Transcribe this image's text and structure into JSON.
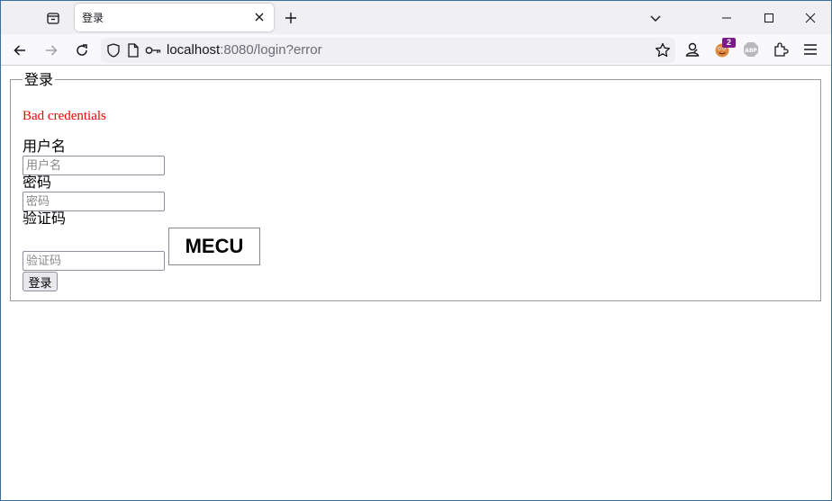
{
  "tab": {
    "title": "登录"
  },
  "browser": {
    "url_host": "localhost",
    "url_rest": ":8080/login?error",
    "extension_badge": "2",
    "icons": [
      "tab-list-icon",
      "close-icon",
      "plus-icon",
      "chevron-down-icon",
      "minimize-icon",
      "maximize-icon",
      "close-icon",
      "back-arrow-icon",
      "forward-arrow-icon",
      "reload-icon",
      "shield-icon",
      "page-icon",
      "key-icon",
      "star-icon",
      "account-icon",
      "cookie-extension-icon",
      "adblock-plus-icon",
      "extensions-puzzle-icon",
      "hamburger-menu-icon"
    ]
  },
  "login": {
    "legend": "登录",
    "error": "Bad credentials",
    "username_label": "用户名",
    "username_placeholder": "用户名",
    "password_label": "密码",
    "password_placeholder": "密码",
    "captcha_label": "验证码",
    "captcha_placeholder": "验证码",
    "captcha_text": "MECU",
    "submit_label": "登录"
  },
  "colors": {
    "error": "#ee0000",
    "badge": "#7a1a8c"
  }
}
